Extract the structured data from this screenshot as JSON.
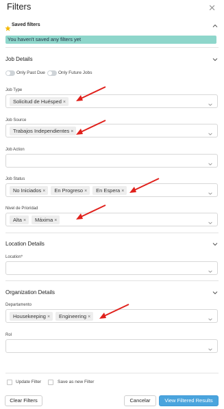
{
  "header": {
    "title": "Filters",
    "close_icon": "close-icon"
  },
  "saved_filters": {
    "title": "Saved filters",
    "banner": "You haven't saved any filters yet"
  },
  "job_details": {
    "title": "Job Details",
    "toggles": [
      {
        "label": "Only Past Due",
        "on": false
      },
      {
        "label": "Only Future Jobs",
        "on": false
      }
    ],
    "job_type": {
      "label": "Job Type",
      "chips": [
        "Solicitud de Huésped"
      ]
    },
    "job_source": {
      "label": "Job Source",
      "chips": [
        "Trabajos Independientes"
      ]
    },
    "job_action": {
      "label": "Job Action",
      "chips": []
    },
    "job_status": {
      "label": "Job Status",
      "chips": [
        "No Iniciados",
        "En Progreso",
        "En Espera"
      ]
    },
    "priority": {
      "label": "Nivel de Prioridad",
      "chips": [
        "Alta",
        "Máxima"
      ]
    }
  },
  "location_details": {
    "title": "Location Details",
    "location": {
      "label": "Location",
      "required_mark": "*",
      "chips": []
    }
  },
  "organization_details": {
    "title": "Organization Details",
    "departamento": {
      "label": "Departamento",
      "chips": [
        "Housekeeping",
        "Engineering"
      ]
    },
    "rol": {
      "label": "Rol",
      "chips": []
    }
  },
  "footer": {
    "update_filter": "Update Filter",
    "save_as_new": "Save as new Filter",
    "clear": "Clear Filters",
    "cancel": "Cancelar",
    "view": "View Filtered Results"
  },
  "colors": {
    "accent": "#4aa4dd",
    "banner": "#8ed6cb",
    "arrow": "#e0201b",
    "star": "#f5b800"
  },
  "chip_remove_glyph": "×"
}
